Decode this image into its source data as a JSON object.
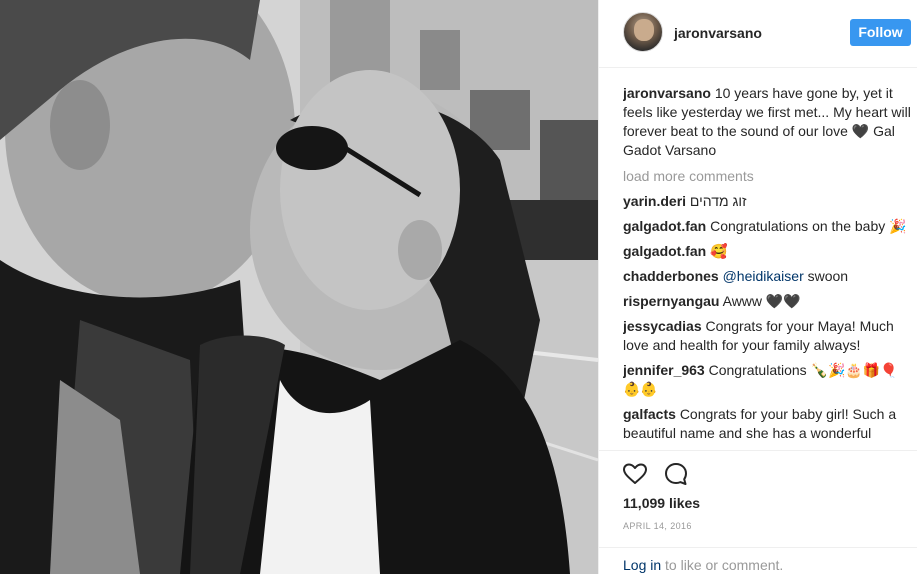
{
  "post": {
    "username": "jaronvarsano",
    "follow_label": "Follow",
    "caption_username": "jaronvarsano",
    "caption_text": "10 years have gone by, yet it feels like yesterday we first met... My heart will forever beat to the sound of our love 🖤 Gal Gadot Varsano",
    "load_more": "load more comments",
    "comments": [
      {
        "user": "yarin.deri",
        "text": "זוג מדהים"
      },
      {
        "user": "galgadot.fan",
        "text": "Congratulations on the baby 🎉"
      },
      {
        "user": "galgadot.fan",
        "text": "🥰"
      },
      {
        "user": "chadderbones",
        "mention": "@heidikaiser",
        "text": "swoon"
      },
      {
        "user": "rispernyangau",
        "text": "Awww 🖤🖤"
      },
      {
        "user": "jessycadias",
        "text": "Congrats for your Maya! Much love and health for your family always!"
      },
      {
        "user": "jennifer_963",
        "text": "Congratulations 🍾🎉🎂🎁🎈👶👶"
      },
      {
        "user": "galfacts",
        "text": "Congrats for your baby girl! Such a beautiful name and she has a wonderful"
      }
    ],
    "likes": "11,099 likes",
    "date": "APRIL 14, 2016",
    "login_link": "Log in",
    "login_text": " to like or comment."
  },
  "icons": {
    "like": "heart-outline-icon",
    "comment": "speech-bubble-icon",
    "avatar": "profile-photo"
  },
  "colors": {
    "follow_button": "#3897f0",
    "link": "#003569",
    "muted": "#999999",
    "text": "#262626"
  }
}
